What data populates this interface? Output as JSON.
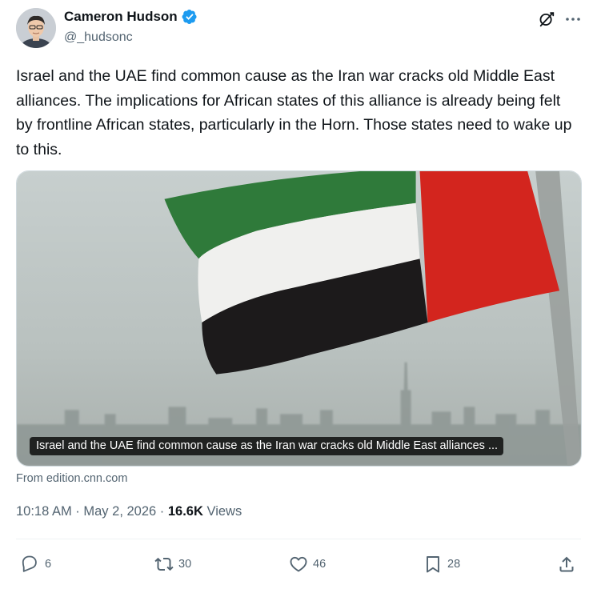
{
  "author": {
    "display_name": "Cameron Hudson",
    "handle": "@_hudsonc",
    "verified": true,
    "avatar_icon": "profile-photo"
  },
  "tweet": {
    "text": "Israel and the UAE find common cause as the Iran war cracks old Middle East alliances. The implications for African states of this alliance is already being felt by frontline African states, particularly in the Horn. Those states need to wake up to this."
  },
  "card": {
    "caption": "Israel and the UAE find common cause as the Iran war cracks old Middle East alliances ...",
    "source": "From edition.cnn.com"
  },
  "meta": {
    "time": "10:18 AM",
    "separator": " · ",
    "date": "May 2, 2026",
    "views_count": "16.6K",
    "views_label": " Views"
  },
  "actions": {
    "replies": "6",
    "retweets": "30",
    "likes": "46",
    "bookmarks": "28"
  },
  "colors": {
    "text_primary": "#0f1419",
    "text_secondary": "#536471",
    "verified_blue": "#1d9bf0",
    "divider": "#eff3f4",
    "flag_green": "#2f7a3a",
    "flag_white": "#f0f0ee",
    "flag_black": "#1c1a1b",
    "flag_red": "#d3251e"
  },
  "icons": [
    "grok-icon",
    "more-icon",
    "verified-badge-icon",
    "reply-icon",
    "retweet-icon",
    "like-icon",
    "bookmark-icon",
    "share-icon"
  ]
}
